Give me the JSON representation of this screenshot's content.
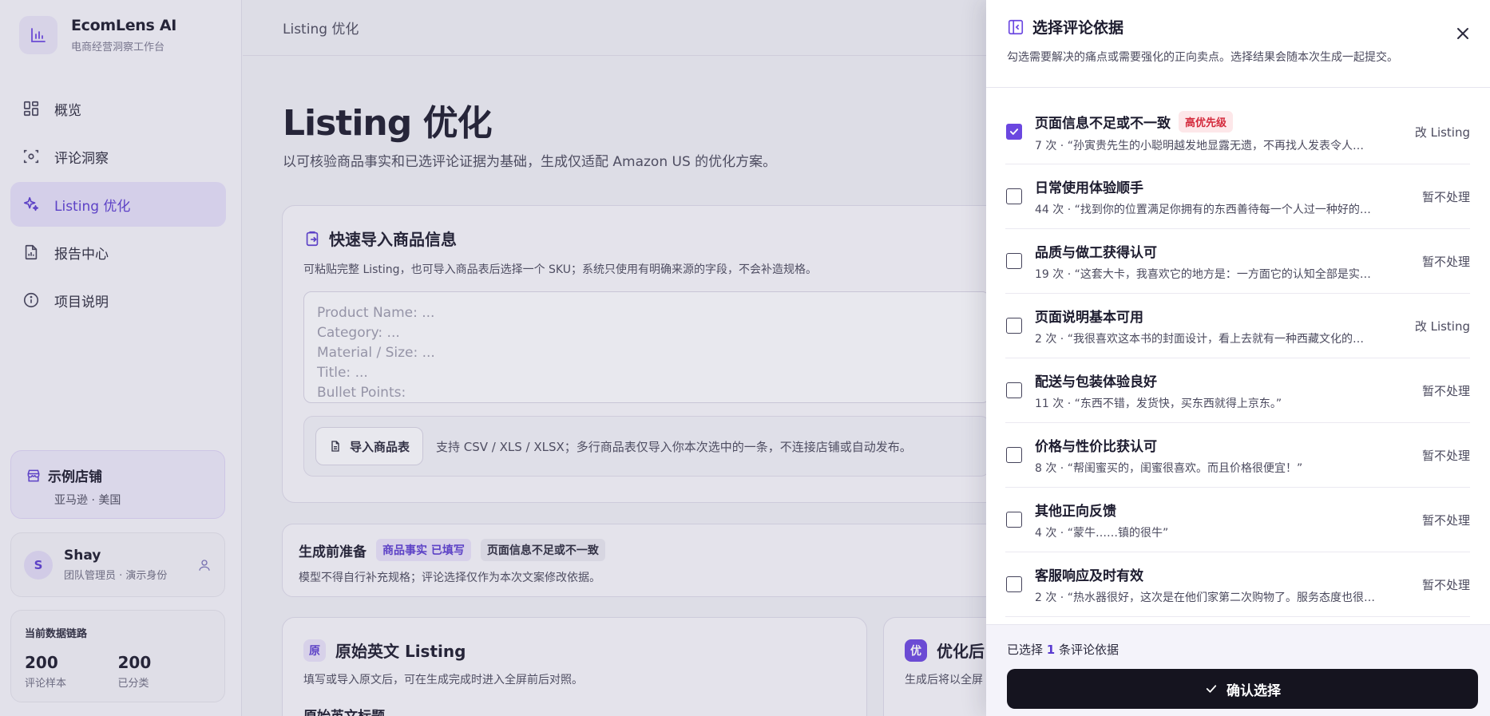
{
  "brand": {
    "name": "EcomLens AI",
    "subtitle": "电商经营洞察工作台"
  },
  "nav": [
    {
      "label": "概览",
      "icon": "dashboard-icon"
    },
    {
      "label": "评论洞察",
      "icon": "scan-icon"
    },
    {
      "label": "Listing 优化",
      "icon": "sparkles-icon",
      "active": true
    },
    {
      "label": "报告中心",
      "icon": "report-icon"
    },
    {
      "label": "项目说明",
      "icon": "info-icon"
    }
  ],
  "store": {
    "title": "示例店铺",
    "subtitle": "亚马逊 · 美国"
  },
  "user": {
    "initial": "S",
    "name": "Shay",
    "role": "团队管理员 · 演示身份"
  },
  "data_chain": {
    "title": "当前数据链路",
    "stats": [
      {
        "value": "200",
        "label": "评论样本"
      },
      {
        "value": "200",
        "label": "已分类"
      }
    ]
  },
  "topbar": {
    "breadcrumb": "Listing 优化"
  },
  "page": {
    "title": "Listing 优化",
    "subtitle": "以可核验商品事实和已选评论证据为基础，生成仅适配 Amazon US 的优化方案。"
  },
  "import": {
    "title": "快速导入商品信息",
    "desc": "可粘贴完整 Listing，也可导入商品表后选择一个 SKU；系统只使用有明确来源的字段，不会补造规格。",
    "placeholder": "Product Name: ...\nCategory: ...\nMaterial / Size: ...\nTitle: ...\nBullet Points:",
    "button": "导入商品表",
    "hint": "支持 CSV / XLS / XLSX；多行商品表仅导入你本次选中的一条，不连接店铺或自动发布。"
  },
  "prep": {
    "title": "生成前准备",
    "chip_facts": "商品事实 已填写",
    "chip_issue": "页面信息不足或不一致",
    "desc": "模型不得自行补充规格；评论选择仅作为本次文案修改依据。"
  },
  "original": {
    "badge": "原",
    "title": "原始英文 Listing",
    "desc": "填写或导入原文后，可在生成完成时进入全屏前后对照。",
    "sub": "原始英文标题"
  },
  "optimized": {
    "badge": "优",
    "title": "优化后",
    "desc": "生成后将以全屏"
  },
  "drawer": {
    "title": "选择评论依据",
    "subtitle": "勾选需要解决的痛点或需要强化的正向卖点。选择结果会随本次生成一起提交。",
    "items": [
      {
        "title": "页面信息不足或不一致",
        "priority": "高优先级",
        "meta": "7 次 · “孙寅贵先生的小聪明越发地显露无遗，不再找人发表令人…",
        "action": "改 Listing",
        "checked": true
      },
      {
        "title": "日常使用体验顺手",
        "priority": "",
        "meta": "44 次 · “找到你的位置满足你拥有的东西善待每一个人过一种好的…",
        "action": "暂不处理",
        "checked": false
      },
      {
        "title": "品质与做工获得认可",
        "priority": "",
        "meta": "19 次 · “这套大卡，我喜欢它的地方是：一方面它的认知全部是实…",
        "action": "暂不处理",
        "checked": false
      },
      {
        "title": "页面说明基本可用",
        "priority": "",
        "meta": "2 次 · “我很喜欢这本书的封面设计，看上去就有一种西藏文化的…",
        "action": "改 Listing",
        "checked": false
      },
      {
        "title": "配送与包装体验良好",
        "priority": "",
        "meta": "11 次 · “东西不错，发货快，买东西就得上京东。”",
        "action": "暂不处理",
        "checked": false
      },
      {
        "title": "价格与性价比获认可",
        "priority": "",
        "meta": "8 次 · “帮闺蜜买的，闺蜜很喜欢。而且价格很便宜！”",
        "action": "暂不处理",
        "checked": false
      },
      {
        "title": "其他正向反馈",
        "priority": "",
        "meta": "4 次 · “蒙牛……镇的很牛”",
        "action": "暂不处理",
        "checked": false
      },
      {
        "title": "客服响应及时有效",
        "priority": "",
        "meta": "2 次 · “热水器很好，这次是在他们家第二次购物了。服务态度也很…",
        "action": "暂不处理",
        "checked": false
      }
    ],
    "footer_prefix": "已选择 ",
    "footer_count": "1",
    "footer_suffix": " 条评论依据",
    "confirm": "确认选择"
  },
  "colors": {
    "accent": "#6b47e0",
    "priority_red": "#d42a3c",
    "confirm_bg": "#15141f"
  }
}
